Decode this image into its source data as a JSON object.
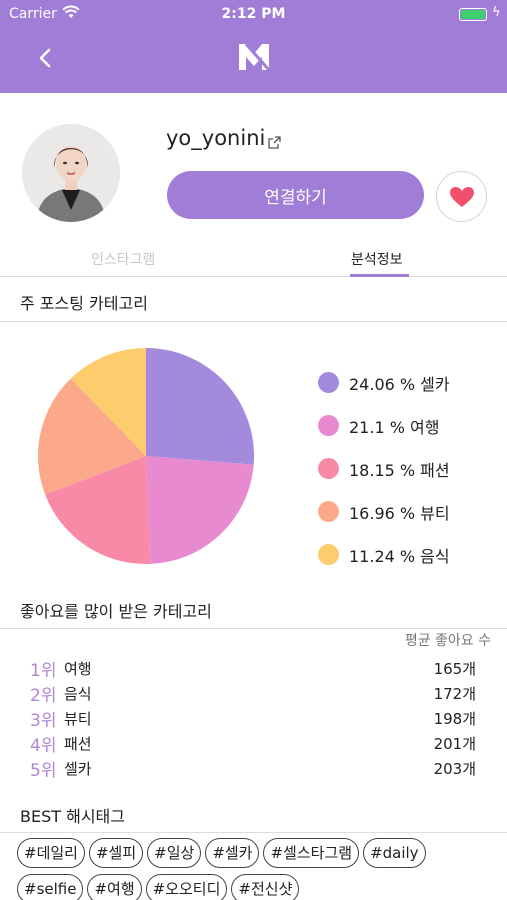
{
  "status_bar": {
    "carrier": "Carrier",
    "time": "2:12 PM",
    "battery_color": "#3cd070"
  },
  "nav": {
    "back_icon": "chevron-left-icon",
    "logo_icon": "brand-logo-icon",
    "color": "#a07ed8"
  },
  "profile": {
    "username": "yo_yonini",
    "external_link_icon": "external-link-icon",
    "connect_label": "연결하기",
    "heart_icon": "heart-icon",
    "heart_color": "#f0506e"
  },
  "tabs": [
    {
      "label": "인스타그램",
      "active": false
    },
    {
      "label": "분석정보",
      "active": true
    }
  ],
  "category_section": {
    "title": "주 포스팅 카테고리"
  },
  "chart_data": {
    "type": "pie",
    "slices": [
      {
        "label": "셀카",
        "value": 24.06,
        "display": "24.06 % 셀카",
        "color": "#a48add"
      },
      {
        "label": "여행",
        "value": 21.1,
        "display": "21.1 % 여행",
        "color": "#e88ad0"
      },
      {
        "label": "패션",
        "value": 18.15,
        "display": "18.15 % 패션",
        "color": "#f88aa8"
      },
      {
        "label": "뷰티",
        "value": 16.96,
        "display": "16.96 % 뷰티",
        "color": "#fba98a"
      },
      {
        "label": "음식",
        "value": 11.24,
        "display": "11.24 % 음식",
        "color": "#fdcc6c"
      }
    ],
    "legend_position": "right"
  },
  "likes_section": {
    "title": "좋아요를 많이 받은 카테고리",
    "avg_header": "평균 좋아요 수",
    "rows": [
      {
        "rank": "1위",
        "name": "여행",
        "value": "165개"
      },
      {
        "rank": "2위",
        "name": "음식",
        "value": "172개"
      },
      {
        "rank": "3위",
        "name": "뷰티",
        "value": "198개"
      },
      {
        "rank": "4위",
        "name": "패션",
        "value": "201개"
      },
      {
        "rank": "5위",
        "name": "셀카",
        "value": "203개"
      }
    ]
  },
  "hashtag_section": {
    "title": "BEST 해시태그",
    "tags": [
      "#데일리",
      "#셀피",
      "#일상",
      "#셀카",
      "#셀스타그램",
      "#daily",
      "#selfie",
      "#여행",
      "#오오티디",
      "#전신샷"
    ]
  }
}
